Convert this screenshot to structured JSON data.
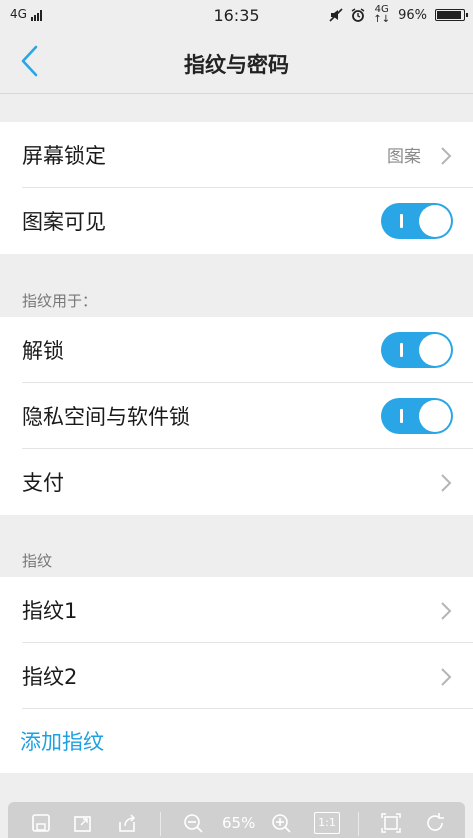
{
  "status_bar": {
    "network": "4G",
    "time": "16:35",
    "network_right": "4G",
    "battery_percent": "96%",
    "battery_level": 0.96
  },
  "header": {
    "title": "指纹与密码"
  },
  "screen_lock": {
    "label": "屏幕锁定",
    "value": "图案"
  },
  "pattern_visible": {
    "label": "图案可见",
    "on": true
  },
  "fingerprint_usage": {
    "section_label": "指纹用于：",
    "items": [
      {
        "label": "解锁",
        "on": true
      },
      {
        "label": "隐私空间与软件锁",
        "on": true
      },
      {
        "label": "支付"
      }
    ]
  },
  "fingerprints": {
    "section_label": "指纹",
    "items": [
      {
        "label": "指纹1"
      },
      {
        "label": "指纹2"
      }
    ],
    "add_label": "添加指纹"
  },
  "toolbar": {
    "zoom": "65%",
    "fit_label": "1:1"
  },
  "colors": {
    "accent": "#2aa6e6",
    "link": "#1da1e0",
    "background": "#eeeeee"
  }
}
